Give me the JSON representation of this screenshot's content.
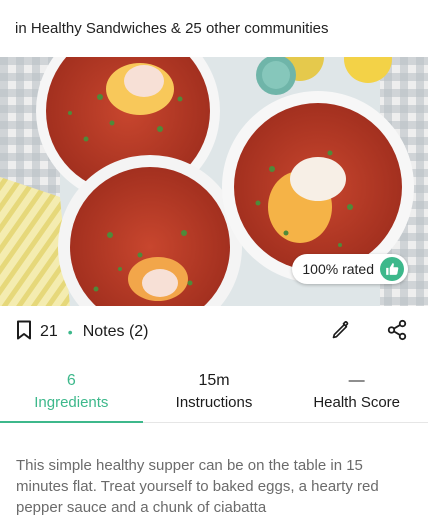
{
  "communities_text": "in Healthy Sandwiches & 25 other communities",
  "hero": {
    "rated_label": "100% rated"
  },
  "actions": {
    "save_count": "21",
    "notes_label": "Notes (2)"
  },
  "tabs": [
    {
      "top": "6",
      "label": "Ingredients",
      "active": true
    },
    {
      "top": "15m",
      "label": "Instructions",
      "active": false
    },
    {
      "top": "—",
      "label": "Health Score",
      "active": false
    }
  ],
  "description": "This simple healthy supper can be on the table in 15 minutes flat. Treat yourself to baked eggs, a hearty red pepper sauce and a chunk of ciabatta",
  "colors": {
    "accent": "#3db88b"
  },
  "icons": [
    "bookmark-icon",
    "pencil-icon",
    "share-icon",
    "thumbs-up-icon"
  ]
}
